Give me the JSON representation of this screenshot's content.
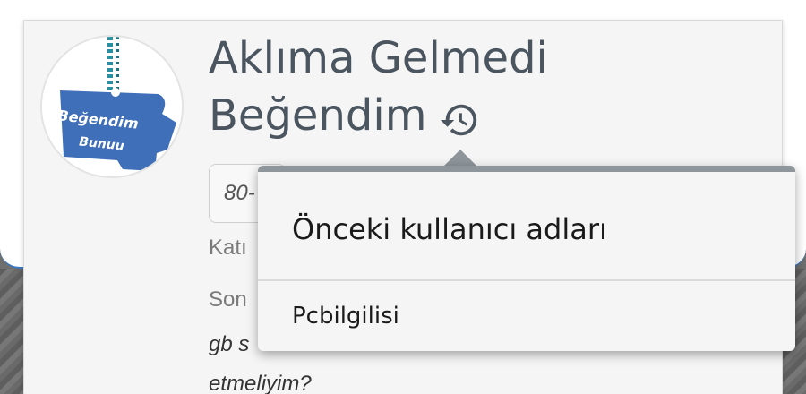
{
  "profile": {
    "username_line1": "Aklıma Gelmedi",
    "username_line2": "Beğendim",
    "avatar_alt": "Beğendim Bunuu",
    "avatar_text_line1": "Beğendim",
    "avatar_text_line2": "Bunuu",
    "badge_text": "80-",
    "joined_label": "Katı",
    "last_seen_label": "Son",
    "signature_line1": "gb s",
    "signature_line2": "etmeliyim?"
  },
  "popup": {
    "title": "Önceki kullanıcı adları",
    "items": [
      "Pcbilgilisi"
    ]
  },
  "icons": {
    "history": "history-icon"
  },
  "colors": {
    "accent": "#3b78c0",
    "popup_border": "#8e959b",
    "username_text": "#4a5560"
  }
}
